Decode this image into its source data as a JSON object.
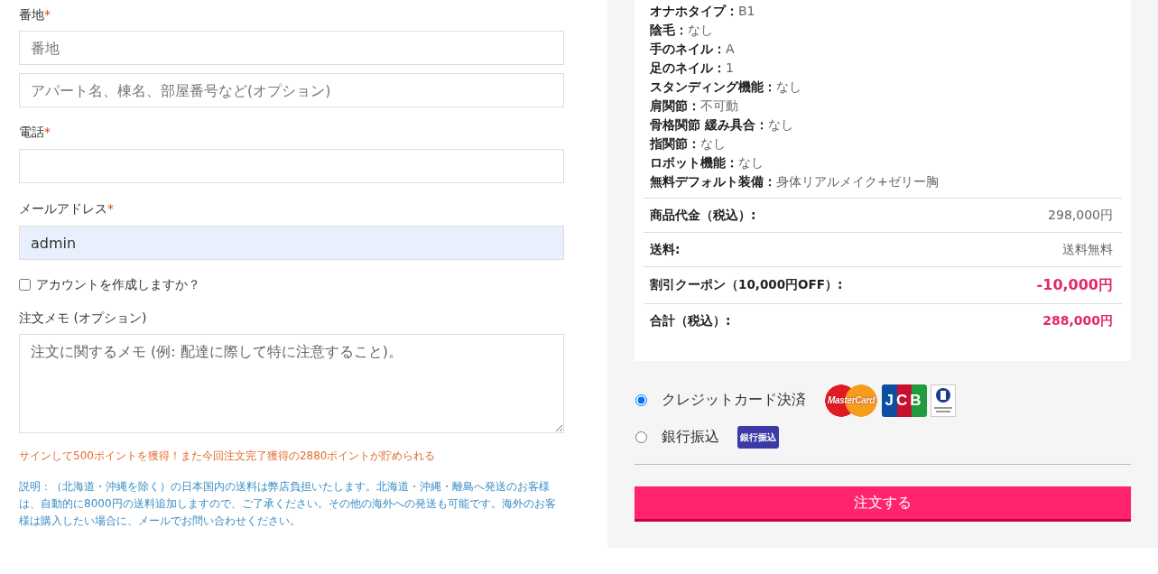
{
  "address": {
    "label": "番地",
    "required_mark": "*",
    "fields": [
      {
        "placeholder": "番地"
      },
      {
        "placeholder": "アパート名、棟名、部屋番号など(オプション)"
      }
    ]
  },
  "phone": {
    "label": "電話",
    "required_mark": "*"
  },
  "email": {
    "label": "メールアドレス",
    "required_mark": "*",
    "value": "admin",
    "autofilled": true
  },
  "create_account": {
    "label": "アカウントを作成しますか？",
    "checked": false
  },
  "order_notes": {
    "label": "注文メモ (オプション)",
    "placeholder": "注文に関するメモ (例: 配達に際して特に注意すること)。"
  },
  "points_notice": "サインして500ポイントを獲得！また今回注文完了獲得の2880ポイントが貯められる",
  "shipping_note": "説明：（北海道・沖縄を除く）の日本国内の送料は弊店負担いたします。北海道・沖縄・離島へ発送のお客様は、自動的に8000円の送料追加しますので、ご了承ください。その他の海外への発送も可能です。海外のお客様は購入したい場合に、メールでお問い合わせください。",
  "product_specs": [
    {
      "name": "オナホタイプ：",
      "value": "B1"
    },
    {
      "name": "陰毛：",
      "value": "なし"
    },
    {
      "name": "手のネイル：",
      "value": "A"
    },
    {
      "name": "足のネイル：",
      "value": "1"
    },
    {
      "name": "スタンディング機能：",
      "value": "なし"
    },
    {
      "name": "肩関節：",
      "value": "不可動"
    },
    {
      "name": "骨格関節 緩み具合：",
      "value": "なし"
    },
    {
      "name": "指関節：",
      "value": "なし"
    },
    {
      "name": "ロボット機能：",
      "value": "なし"
    },
    {
      "name": "無料デフォルト装備：",
      "value": "身体リアルメイク+ゼリー胸"
    }
  ],
  "totals": [
    {
      "label": "商品代金（税込）:",
      "value": "298,000円",
      "kind": "normal"
    },
    {
      "label": "送料:",
      "value": "送料無料",
      "kind": "normal"
    },
    {
      "label": "割引クーポン（10,000円OFF）:",
      "value": "-10,000円",
      "kind": "discount"
    },
    {
      "label": "合計（税込）:",
      "value": "288,000円",
      "kind": "total"
    }
  ],
  "payment_methods": [
    {
      "label": "クレジットカード決済",
      "selected": true,
      "logos": [
        {
          "kind": "mastercard",
          "text": "MasterCard"
        },
        {
          "kind": "jcb",
          "text": "JCB"
        },
        {
          "kind": "diners"
        }
      ]
    },
    {
      "label": "銀行振込",
      "selected": false,
      "logos": [
        {
          "kind": "badge",
          "text": "銀行振込"
        }
      ]
    }
  ],
  "place_order_button": "注文する"
}
